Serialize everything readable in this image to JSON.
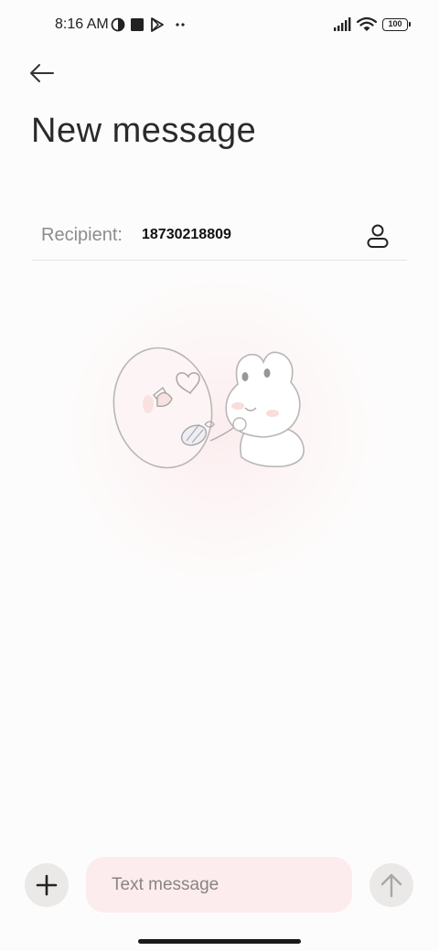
{
  "status_bar": {
    "time": "8:16 AM",
    "battery_level": "100",
    "icons": [
      "data-saver-icon",
      "stop-square-icon",
      "play-store-icon",
      "more-dots-icon",
      "signal-icon",
      "wifi-icon",
      "battery-icon"
    ]
  },
  "header": {
    "back_icon": "arrow-left-icon",
    "title": "New message"
  },
  "recipient": {
    "label": "Recipient:",
    "value": "18730218809",
    "contact_icon": "person-icon"
  },
  "composer": {
    "add_icon": "plus-icon",
    "placeholder": "Text message",
    "value": "",
    "send_icon": "arrow-up-icon"
  },
  "colors": {
    "background": "#fdfcfc",
    "input_background": "#fcecee",
    "button_background": "#ebe8e8",
    "title_text": "#2a2a2a",
    "label_text": "#8c8c8c"
  }
}
